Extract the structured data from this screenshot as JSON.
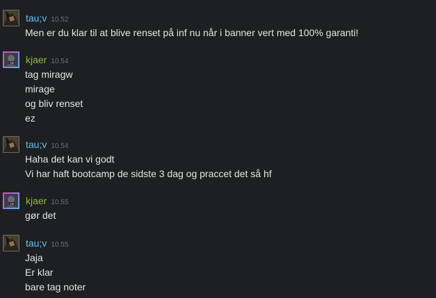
{
  "messages": [
    {
      "user": "tau;v",
      "time": "10.52",
      "lines": [
        "Men er du klar til at blive renset på inf nu når i banner vert med 100% garanti!"
      ]
    },
    {
      "user": "kjaer",
      "time": "10.54",
      "lines": [
        "tag miragw",
        "mirage",
        "og bliv renset",
        "ez"
      ]
    },
    {
      "user": "tau;v",
      "time": "10.54",
      "lines": [
        "Haha det kan vi godt",
        "Vi har haft bootcamp de sidste 3 dag og praccet det så hf"
      ]
    },
    {
      "user": "kjaer",
      "time": "10.55",
      "lines": [
        "gør det"
      ]
    },
    {
      "user": "tau;v",
      "time": "10.55",
      "lines": [
        "Jaja",
        "Er klar",
        "bare tag noter"
      ]
    }
  ],
  "colors": {
    "background": "#1e1f22",
    "tau_name": "#62c0ef",
    "kjaer_name": "#8fba3d",
    "timestamp": "#6c6f75",
    "text": "#e4e4e4"
  },
  "avatar_badge": "24"
}
